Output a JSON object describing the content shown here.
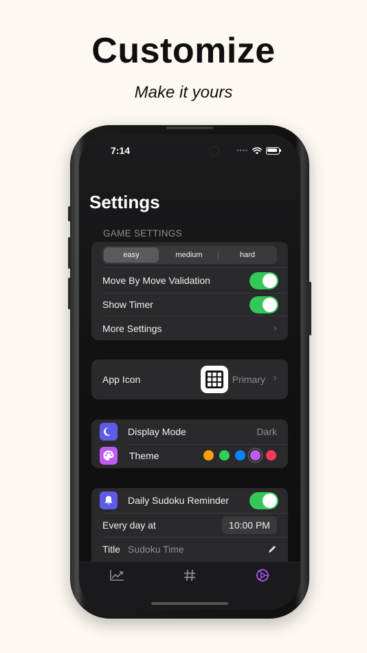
{
  "promo": {
    "headline": "Customize",
    "subheadline": "Make it yours"
  },
  "status_bar": {
    "time": "7:14"
  },
  "screen_title": "Settings",
  "game_settings": {
    "header": "GAME SETTINGS",
    "difficulty": {
      "options": [
        "easy",
        "medium",
        "hard"
      ],
      "selected": "easy"
    },
    "move_validation": {
      "label": "Move By Move Validation",
      "enabled": true
    },
    "show_timer": {
      "label": "Show Timer",
      "enabled": true
    },
    "more_settings": {
      "label": "More Settings"
    }
  },
  "app_icon": {
    "label": "App Icon",
    "value": "Primary"
  },
  "appearance": {
    "display_mode": {
      "label": "Display Mode",
      "value": "Dark",
      "icon": "moon-icon"
    },
    "theme": {
      "label": "Theme",
      "icon": "palette-icon",
      "colors": [
        "#ff9f0a",
        "#30d158",
        "#0a84ff",
        "#bf5af2",
        "#ff375f"
      ],
      "selected_index": 3
    }
  },
  "reminder": {
    "label": "Daily Sudoku Reminder",
    "enabled": true,
    "icon": "bell-icon",
    "schedule_label": "Every day at",
    "time": "10:00 PM",
    "title_label": "Title",
    "title_value": "Sudoku Time"
  },
  "tabs": [
    {
      "icon": "chart-icon",
      "active": false
    },
    {
      "icon": "hashtag-icon",
      "active": false
    },
    {
      "icon": "gear-icon",
      "active": true
    }
  ],
  "colors": {
    "accent": "#a855f7",
    "toggle_on": "#34c759",
    "background": "#fdf8f1"
  }
}
